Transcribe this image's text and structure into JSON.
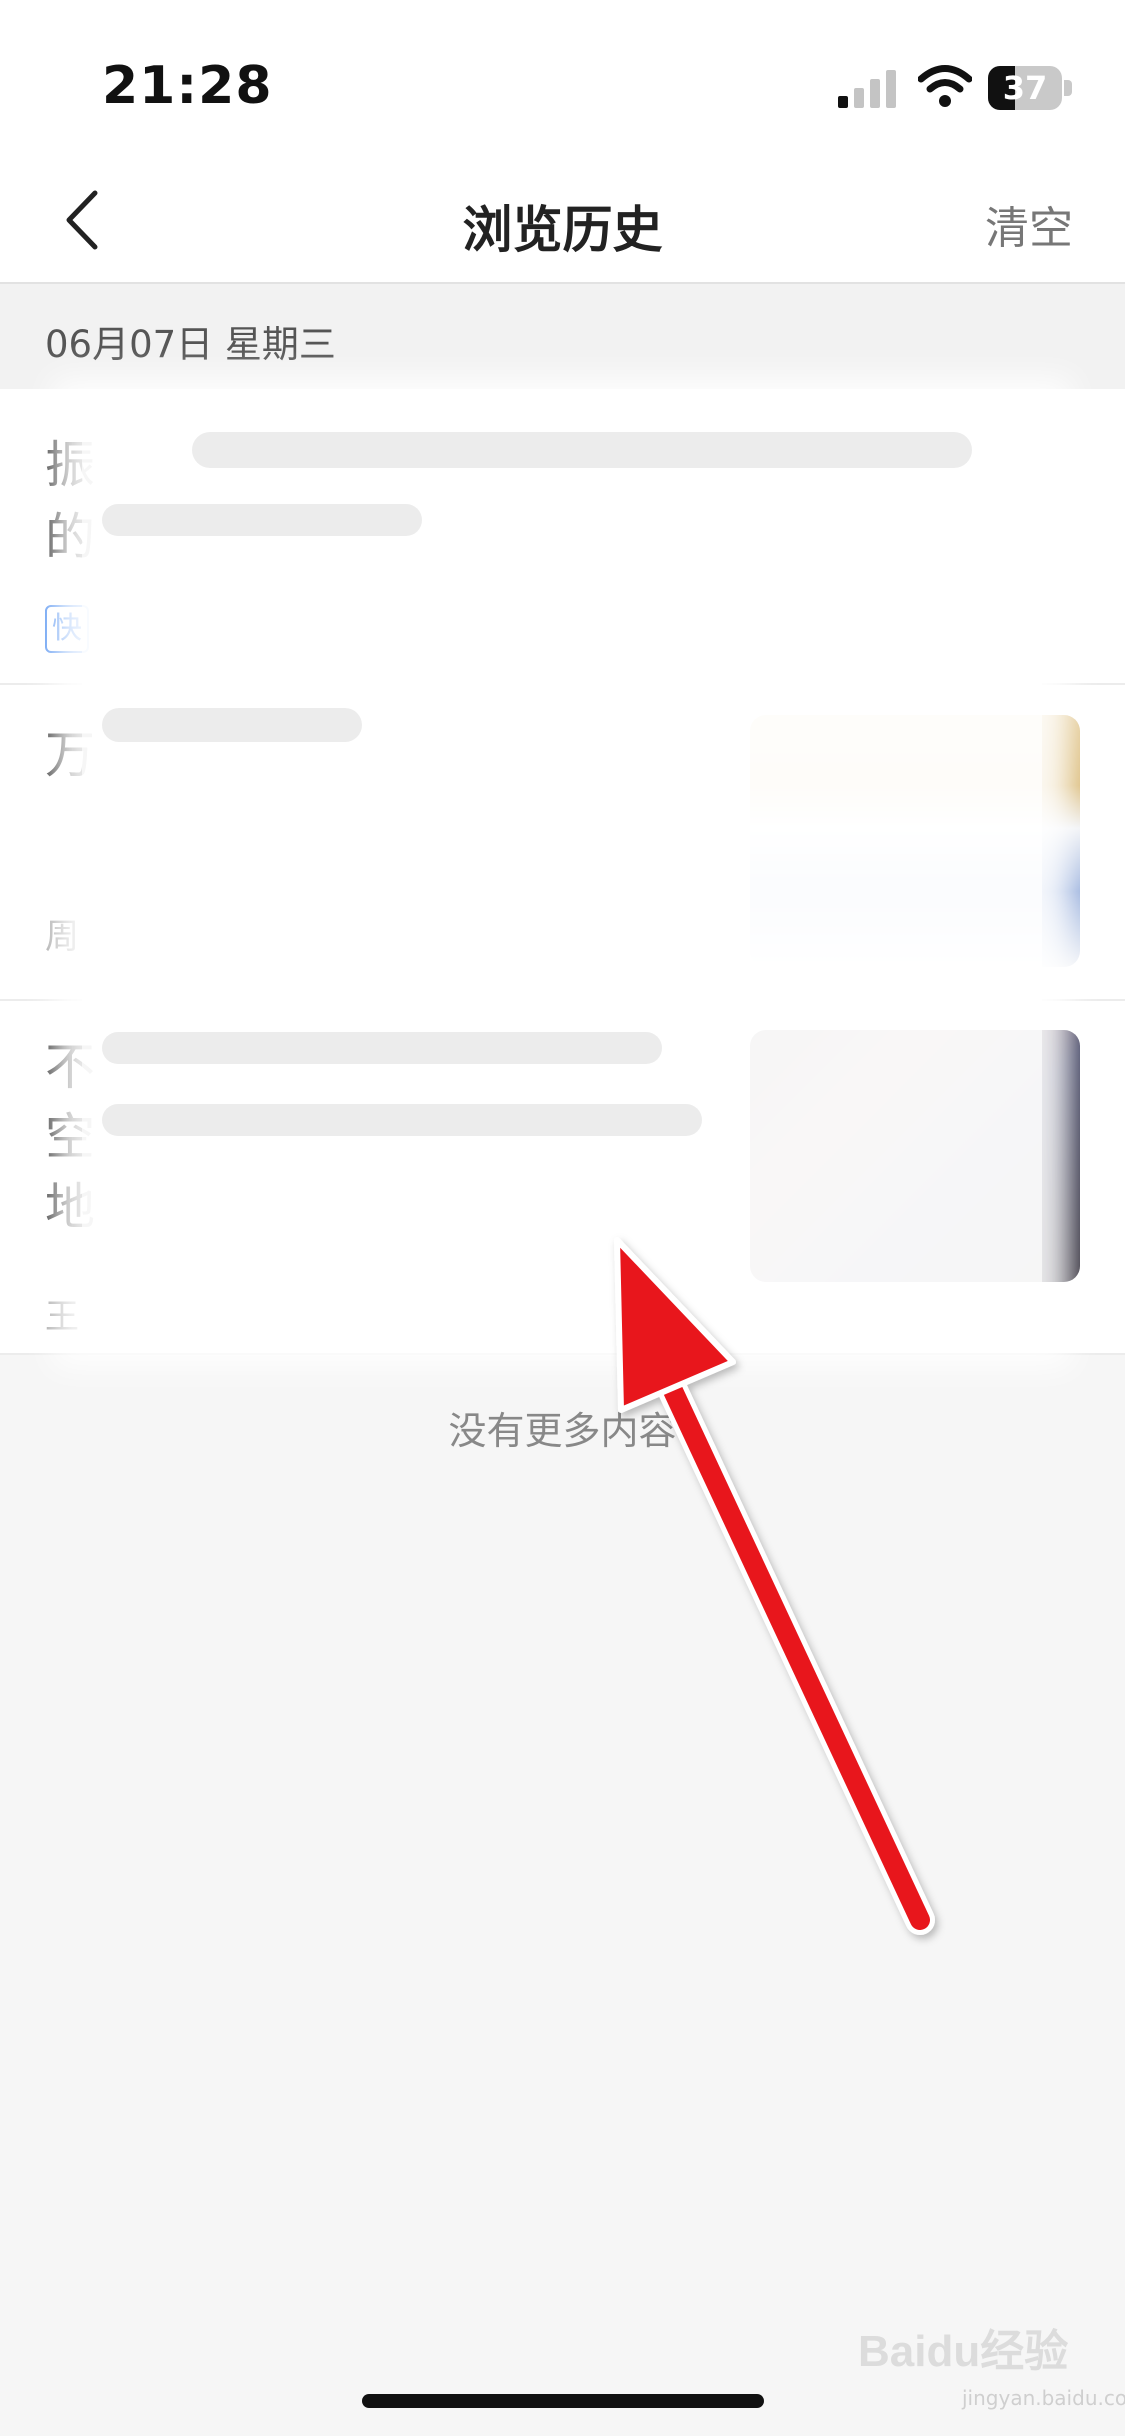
{
  "status_bar": {
    "time": "21:28",
    "battery_level": "37",
    "battery_fraction": 0.37
  },
  "nav": {
    "title": "浏览历史",
    "clear_label": "清空"
  },
  "history": {
    "date_label": "06月07日 星期三",
    "items": [
      {
        "title_line1": "振",
        "title_line2": "的",
        "tag": "快",
        "meta": ""
      },
      {
        "title_line1": "万",
        "meta": "周"
      },
      {
        "title_line1": "不",
        "title_line2": "空",
        "title_line3": "地",
        "meta": "王"
      }
    ]
  },
  "footer": {
    "no_more": "没有更多内容"
  },
  "watermark": {
    "text": "Baidu经验",
    "url": "jingyan.baidu.com"
  },
  "colors": {
    "accent_tag": "#4a8cf0",
    "arrow": "#e8141e"
  }
}
